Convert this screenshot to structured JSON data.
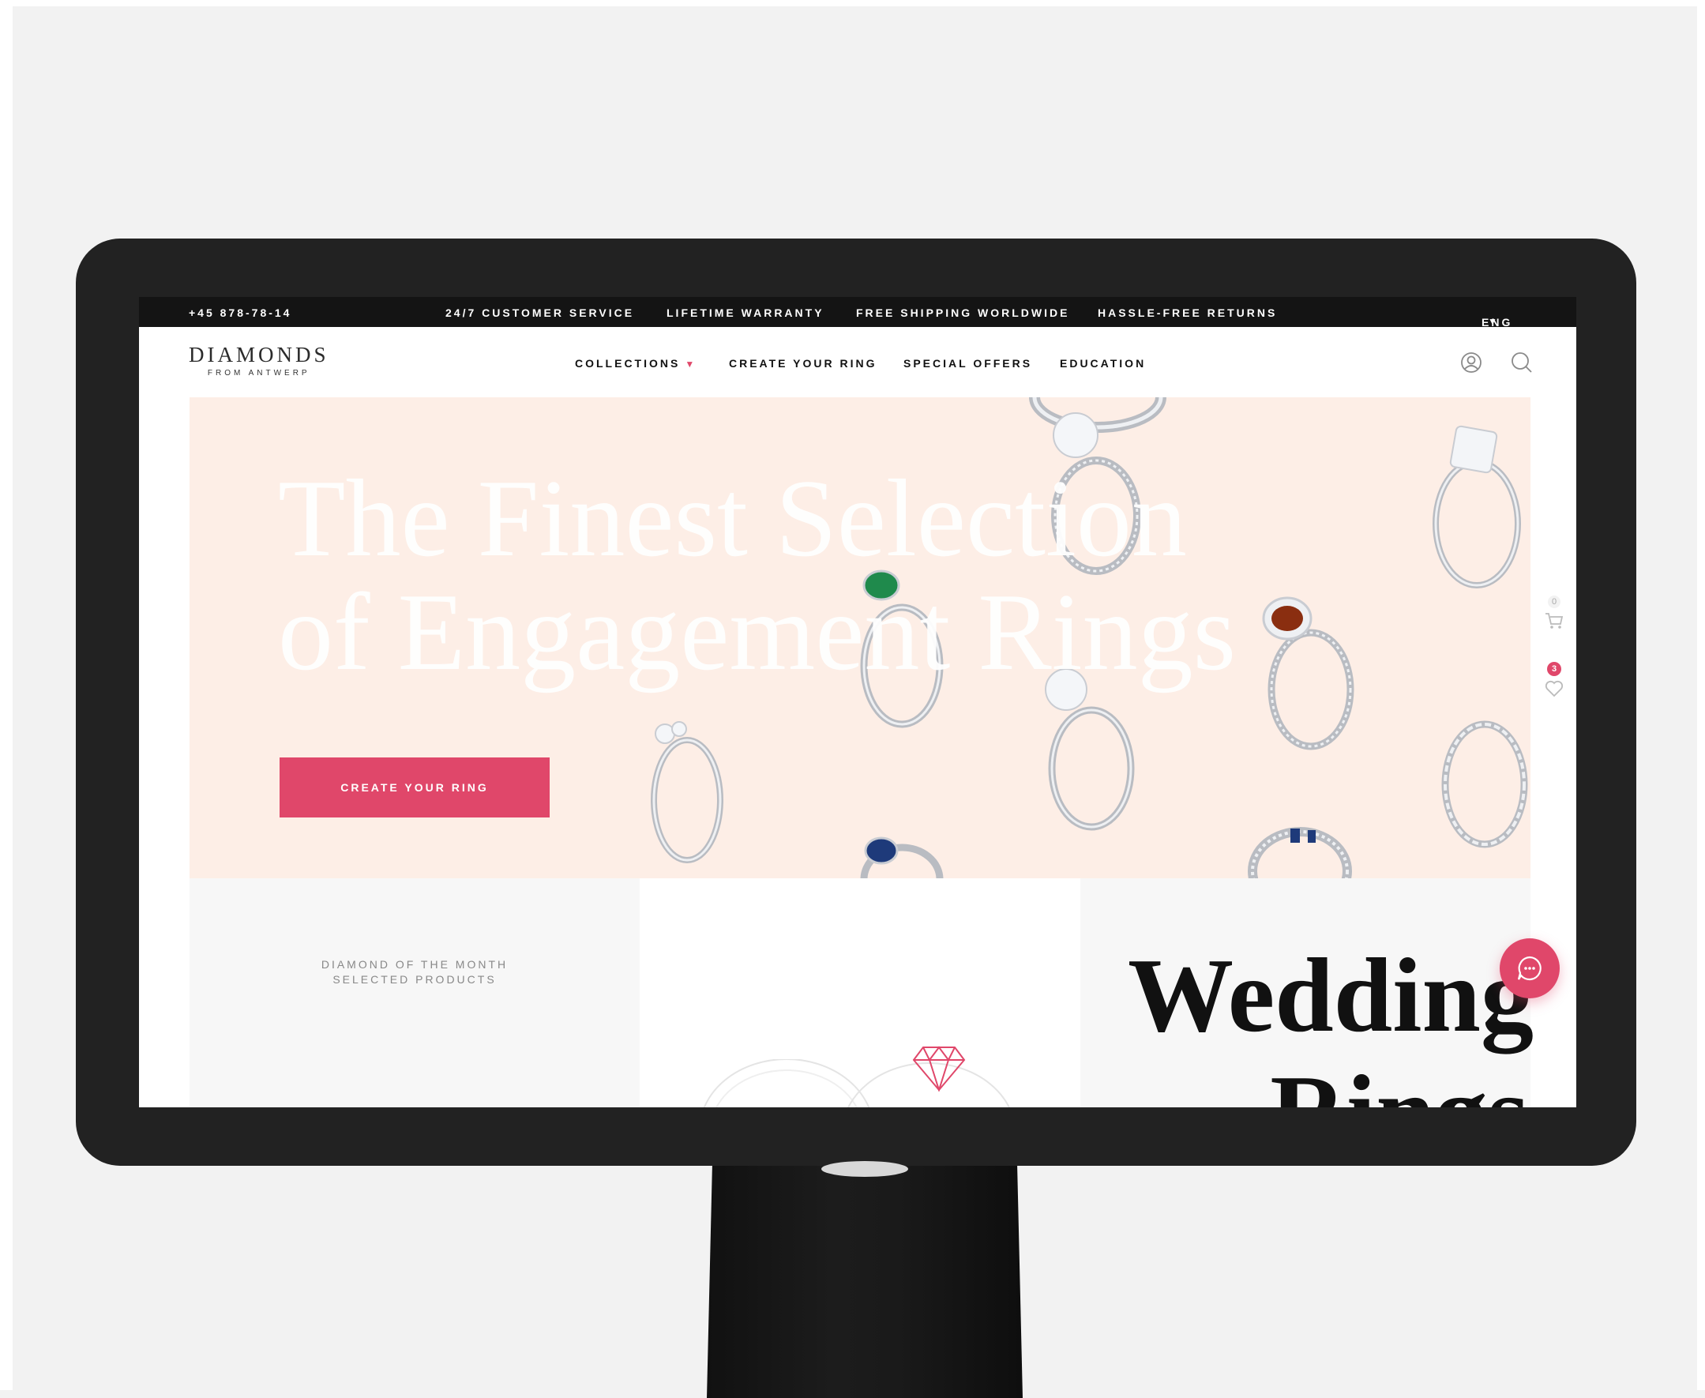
{
  "colors": {
    "accent": "#e0476a",
    "topbar": "#141414",
    "hero_bg": "#fdeee6",
    "monitor": "#222222"
  },
  "topbar": {
    "phone": "+45 878-78-14",
    "items": [
      "24/7 CUSTOMER SERVICE",
      "LIFETIME WARRANTY",
      "FREE SHIPPING WORLDWIDE",
      "HASSLE-FREE RETURNS"
    ],
    "language": "ENG"
  },
  "header": {
    "logo_main": "DIAMONDS",
    "logo_sub": "FROM ANTWERP",
    "nav": {
      "collections": "COLLECTIONS",
      "create": "CREATE YOUR RING",
      "offers": "SPECIAL OFFERS",
      "education": "EDUCATION"
    },
    "icons": [
      "user-icon",
      "search-icon"
    ]
  },
  "hero": {
    "title": "The Finest Selection of Engagement Rings",
    "cta_label": "CREATE YOUR RING"
  },
  "featured": {
    "line1": "DIAMOND OF THE MONTH",
    "line2": "SELECTED PRODUCTS"
  },
  "wedding": {
    "line1": "Wedding",
    "line2": "Rings"
  },
  "side": {
    "cart_count": "0",
    "favorites_count": "3"
  }
}
